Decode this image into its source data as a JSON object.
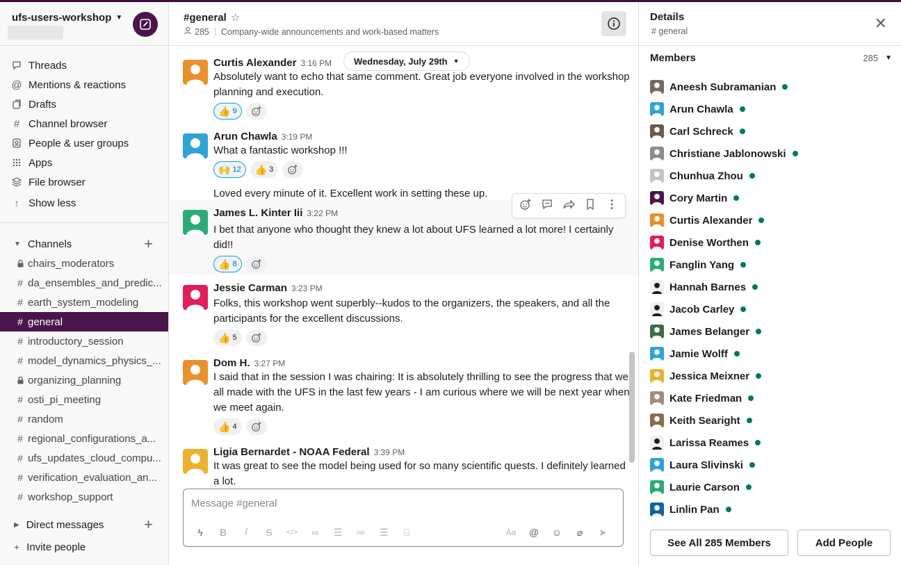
{
  "workspace": {
    "name": "ufs-users-workshop"
  },
  "nav": [
    {
      "label": "Threads",
      "icon": "threads-icon"
    },
    {
      "label": "Mentions & reactions",
      "icon": "at-icon"
    },
    {
      "label": "Drafts",
      "icon": "drafts-icon"
    },
    {
      "label": "Channel browser",
      "icon": "channel-browser-icon"
    },
    {
      "label": "People & user groups",
      "icon": "people-icon"
    },
    {
      "label": "Apps",
      "icon": "apps-icon"
    },
    {
      "label": "File browser",
      "icon": "files-icon"
    },
    {
      "label": "Show less",
      "icon": "arrow-up-icon"
    }
  ],
  "channels_header": "Channels",
  "channels": [
    {
      "name": "chairs_moderators",
      "private": true
    },
    {
      "name": "da_ensembles_and_predic...",
      "private": false
    },
    {
      "name": "earth_system_modeling",
      "private": false
    },
    {
      "name": "general",
      "private": false,
      "active": true
    },
    {
      "name": "introductory_session",
      "private": false
    },
    {
      "name": "model_dynamics_physics_...",
      "private": false
    },
    {
      "name": "organizing_planning",
      "private": true
    },
    {
      "name": "osti_pi_meeting",
      "private": false
    },
    {
      "name": "random",
      "private": false
    },
    {
      "name": "regional_configurations_a...",
      "private": false
    },
    {
      "name": "ufs_updates_cloud_compu...",
      "private": false
    },
    {
      "name": "verification_evaluation_an...",
      "private": false
    },
    {
      "name": "workshop_support",
      "private": false
    }
  ],
  "dm_header": "Direct messages",
  "invite_label": "Invite people",
  "channel": {
    "title": "#general",
    "member_count": "285",
    "topic": "Company-wide announcements and work-based matters"
  },
  "date_divider": "Wednesday, July 29th",
  "messages": [
    {
      "author": "Curtis Alexander",
      "time": "3:16 PM",
      "avatar_color": "#e8912d",
      "text": "Absolutely want to echo that same comment.  Great job everyone involved in the workshop planning and execution.",
      "reactions": [
        {
          "emoji": "👍",
          "count": "9",
          "mine": true
        }
      ]
    },
    {
      "author": "Arun Chawla",
      "time": "3:19 PM",
      "avatar_color": "#2fa3d6",
      "text": "What a fantastic workshop !!!",
      "reactions": [
        {
          "emoji": "🙌",
          "count": "12",
          "mine": true
        },
        {
          "emoji": "👍",
          "count": "3",
          "mine": false
        }
      ]
    },
    {
      "author": "",
      "time": "",
      "avatar_color": "",
      "text": "Loved every minute of it. Excellent work in setting these up.",
      "reactions": []
    },
    {
      "author": "James L. Kinter Iii",
      "time": "3:22 PM",
      "avatar_color": "#2bac76",
      "text": "I bet that anyone who thought they knew a lot about UFS learned a lot more! I certainly did!!",
      "reactions": [
        {
          "emoji": "👍",
          "count": "8",
          "mine": true
        }
      ]
    },
    {
      "author": "Jessie Carman",
      "time": "3:23 PM",
      "avatar_color": "#e01e5a",
      "text": "Folks, this workshop went superbly--kudos to the organizers, the speakers, and all the participants for the excellent discussions.",
      "reactions": [
        {
          "emoji": "👍",
          "count": "5",
          "mine": false
        }
      ]
    },
    {
      "author": "Dom H.",
      "time": "3:27 PM",
      "avatar_color": "#e8912d",
      "text": "I said that in the session I was chairing: It is absolutely thrilling to see the progress that we all made with the UFS in the last few years - I am curious where we will be next year when we meet again.",
      "reactions": [
        {
          "emoji": "👍",
          "count": "4",
          "mine": false
        }
      ]
    },
    {
      "author": "Ligia Bernardet - NOAA Federal",
      "time": "3:39 PM",
      "avatar_color": "#ecb22e",
      "text": "It was great to see the model being used for so many scientific quests. I definitely learned a lot.",
      "reactions": []
    }
  ],
  "composer": {
    "placeholder": "Message #general"
  },
  "details": {
    "title": "Details",
    "subtitle": "# general",
    "members_label": "Members",
    "members_count": "285",
    "members": [
      {
        "name": "Aneesh Subramanian",
        "color": "#7a6a5c"
      },
      {
        "name": "Arun Chawla",
        "color": "#2fa3d6"
      },
      {
        "name": "Carl Schreck",
        "color": "#6b5b4e"
      },
      {
        "name": "Christiane Jablonowski",
        "color": "#8c8c8c"
      },
      {
        "name": "Chunhua Zhou",
        "color": "#c4c4c4"
      },
      {
        "name": "Cory Martin",
        "color": "#4a154b"
      },
      {
        "name": "Curtis Alexander",
        "color": "#e8912d"
      },
      {
        "name": "Denise Worthen",
        "color": "#e01e5a"
      },
      {
        "name": "Fanglin Yang",
        "color": "#2bac76"
      },
      {
        "name": "Hannah Barnes",
        "color": "#f0f0f0"
      },
      {
        "name": "Jacob Carley",
        "color": "#f0f0f0"
      },
      {
        "name": "James Belanger",
        "color": "#3c6e47"
      },
      {
        "name": "Jamie Wolff",
        "color": "#2fa3d6"
      },
      {
        "name": "Jessica Meixner",
        "color": "#ecb22e"
      },
      {
        "name": "Kate Friedman",
        "color": "#a58a80"
      },
      {
        "name": "Keith Searight",
        "color": "#8a6b4a"
      },
      {
        "name": "Larissa Reames",
        "color": "#f0f0f0"
      },
      {
        "name": "Laura Slivinski",
        "color": "#2fa3d6"
      },
      {
        "name": "Laurie Carson",
        "color": "#2bac76"
      },
      {
        "name": "Linlin Pan",
        "color": "#1264a3"
      }
    ],
    "see_all_label": "See All 285 Members",
    "add_people_label": "Add People"
  },
  "colors": {
    "aubergine": "#4a154b",
    "online": "#007a5a",
    "mine_reaction": "#1d9bd1"
  }
}
